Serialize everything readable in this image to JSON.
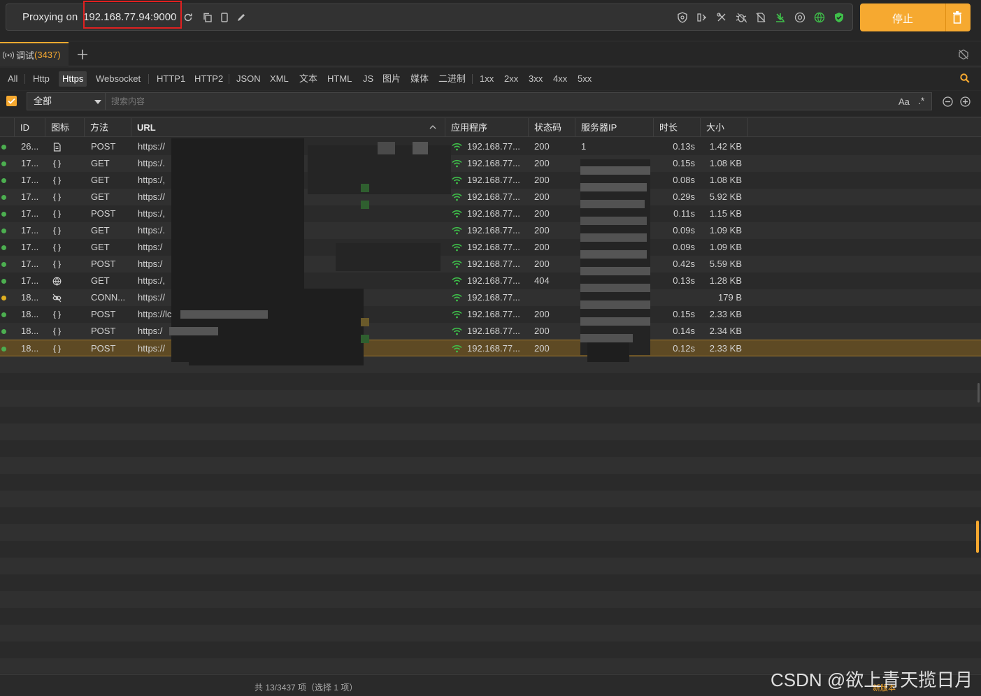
{
  "toolbar": {
    "proxy_label": "Proxying on",
    "proxy_address": "192.168.77.94:9000",
    "stop_label": "停止",
    "accent": "#f6a930"
  },
  "tabs": {
    "debug_label": "调试",
    "debug_count": "(3437)"
  },
  "filters": [
    "All",
    "Http",
    "Https",
    "Websocket",
    "HTTP1",
    "HTTP2",
    "JSON",
    "XML",
    "文本",
    "HTML",
    "JS",
    "图片",
    "媒体",
    "二进制",
    "1xx",
    "2xx",
    "3xx",
    "4xx",
    "5xx"
  ],
  "active_filter": "Https",
  "search": {
    "scope": "全部",
    "placeholder": "搜索内容",
    "case_label": "Aa",
    "regex_label": ".*"
  },
  "columns": [
    "ID",
    "图标",
    "方法",
    "URL",
    "应用程序",
    "状态码",
    "服务器IP",
    "时长",
    "大小"
  ],
  "rows": [
    {
      "dot": "#4caf50",
      "id": "26...",
      "icon": "document-icon",
      "method": "POST",
      "url": "https://",
      "app": "192.168.77...",
      "status": "200",
      "ip": "1",
      "duration": "0.13s",
      "size": "1.42 KB"
    },
    {
      "dot": "#4caf50",
      "id": "17...",
      "icon": "json-braces-icon",
      "method": "GET",
      "url": "https:/.",
      "app": "192.168.77...",
      "status": "200",
      "ip": "",
      "duration": "0.15s",
      "size": "1.08 KB"
    },
    {
      "dot": "#4caf50",
      "id": "17...",
      "icon": "json-braces-icon",
      "method": "GET",
      "url": "https:/,",
      "app": "192.168.77...",
      "status": "200",
      "ip": "",
      "duration": "0.08s",
      "size": "1.08 KB"
    },
    {
      "dot": "#4caf50",
      "id": "17...",
      "icon": "json-braces-icon",
      "method": "GET",
      "url": "https://",
      "app": "192.168.77...",
      "status": "200",
      "ip": "",
      "duration": "0.29s",
      "size": "5.92 KB"
    },
    {
      "dot": "#4caf50",
      "id": "17...",
      "icon": "json-braces-icon",
      "method": "POST",
      "url": "https:/,",
      "app": "192.168.77...",
      "status": "200",
      "ip": "",
      "duration": "0.11s",
      "size": "1.15 KB"
    },
    {
      "dot": "#4caf50",
      "id": "17...",
      "icon": "json-braces-icon",
      "method": "GET",
      "url": "https:/.",
      "app": "192.168.77...",
      "status": "200",
      "ip": "",
      "duration": "0.09s",
      "size": "1.09 KB"
    },
    {
      "dot": "#4caf50",
      "id": "17...",
      "icon": "json-braces-icon",
      "method": "GET",
      "url": "https:/",
      "app": "192.168.77...",
      "status": "200",
      "ip": "",
      "duration": "0.09s",
      "size": "1.09 KB"
    },
    {
      "dot": "#4caf50",
      "id": "17...",
      "icon": "json-braces-icon",
      "method": "POST",
      "url": "https:/",
      "app": "192.168.77...",
      "status": "200",
      "ip": "",
      "duration": "0.42s",
      "size": "5.59 KB"
    },
    {
      "dot": "#4caf50",
      "id": "17...",
      "icon": "globe-icon",
      "method": "GET",
      "url": "https:/,",
      "app": "192.168.77...",
      "status": "404",
      "ip": "",
      "duration": "0.13s",
      "size": "1.28 KB"
    },
    {
      "dot": "#e0b020",
      "id": "18...",
      "icon": "link-broken-icon",
      "method": "CONN...",
      "url": "https://",
      "app": "192.168.77...",
      "status": "",
      "ip": "",
      "duration": "",
      "size": "179 B"
    },
    {
      "dot": "#4caf50",
      "id": "18...",
      "icon": "json-braces-icon",
      "method": "POST",
      "url": "https://lc",
      "app": "192.168.77...",
      "status": "200",
      "ip": "",
      "duration": "0.15s",
      "size": "2.33 KB"
    },
    {
      "dot": "#4caf50",
      "id": "18...",
      "icon": "json-braces-icon",
      "method": "POST",
      "url": "https:/",
      "app": "192.168.77...",
      "status": "200",
      "ip": "",
      "duration": "0.14s",
      "size": "2.34 KB"
    },
    {
      "dot": "#4caf50",
      "id": "18...",
      "icon": "json-braces-icon",
      "method": "POST",
      "url": "https://",
      "app": "192.168.77...",
      "status": "200",
      "ip": "",
      "duration": "0.12s",
      "size": "2.33 KB",
      "selected": true
    }
  ],
  "status_bar": {
    "summary": "共 13/3437 项（选择 1 项）",
    "new_version": "新版本"
  },
  "watermark": "CSDN @欲上青天揽日月"
}
